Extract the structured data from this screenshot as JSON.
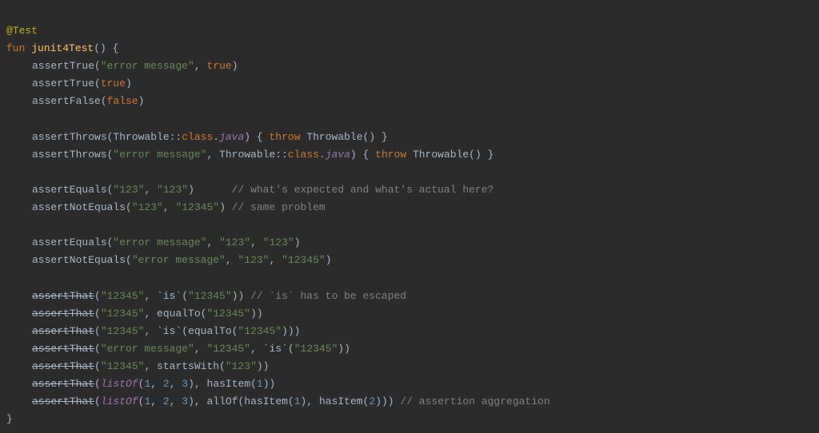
{
  "line1": {
    "annot": "@Test"
  },
  "line2": {
    "kw1": "fun",
    "fn": "junit4Test",
    "after": "() {"
  },
  "line3": {
    "call": "assertTrue(",
    "str": "\"error message\"",
    "rest": ", ",
    "kw": "true",
    "end": ")"
  },
  "line4": {
    "call": "assertTrue(",
    "kw": "true",
    "end": ")"
  },
  "line5": {
    "call": "assertFalse(",
    "kw": "false",
    "end": ")"
  },
  "line7": {
    "a": "assertThrows(Throwable::",
    "cls": "class",
    "dot": ".",
    "java": "java",
    "b": ") { ",
    "kw": "throw",
    "c": " Throwable() }"
  },
  "line8": {
    "a": "assertThrows(",
    "str": "\"error message\"",
    "b": ", Throwable::",
    "cls": "class",
    "dot": ".",
    "java": "java",
    "c": ") { ",
    "kw": "throw",
    "d": " Throwable() }"
  },
  "line10": {
    "a": "assertEquals(",
    "s1": "\"123\"",
    "b": ", ",
    "s2": "\"123\"",
    "c": ")      ",
    "cm": "// what's expected and what's actual here?"
  },
  "line11": {
    "a": "assertNotEquals(",
    "s1": "\"123\"",
    "b": ", ",
    "s2": "\"12345\"",
    "c": ") ",
    "cm": "// same problem"
  },
  "line13": {
    "a": "assertEquals(",
    "s1": "\"error message\"",
    "b": ", ",
    "s2": "\"123\"",
    "c": ", ",
    "s3": "\"123\"",
    "d": ")"
  },
  "line14": {
    "a": "assertNotEquals(",
    "s1": "\"error message\"",
    "b": ", ",
    "s2": "\"123\"",
    "c": ", ",
    "s3": "\"12345\"",
    "d": ")"
  },
  "line16": {
    "a": "assertThat",
    "b": "(",
    "s1": "\"12345\"",
    "c": ", `is`(",
    "s2": "\"12345\"",
    "d": ")) ",
    "cm": "// `is` has to be escaped"
  },
  "line17": {
    "a": "assertThat",
    "b": "(",
    "s1": "\"12345\"",
    "c": ", equalTo(",
    "s2": "\"12345\"",
    "d": "))"
  },
  "line18": {
    "a": "assertThat",
    "b": "(",
    "s1": "\"12345\"",
    "c": ", `is`(equalTo(",
    "s2": "\"12345\"",
    "d": ")))"
  },
  "line19": {
    "a": "assertThat",
    "b": "(",
    "s1": "\"error message\"",
    "c": ", ",
    "s2": "\"12345\"",
    "d": ", `is`(",
    "s3": "\"12345\"",
    "e": "))"
  },
  "line20": {
    "a": "assertThat",
    "b": "(",
    "s1": "\"12345\"",
    "c": ", startsWith(",
    "s2": "\"123\"",
    "d": "))"
  },
  "line21": {
    "a": "assertThat",
    "b": "(",
    "fn": "listOf",
    "c": "(",
    "n1": "1",
    "d": ", ",
    "n2": "2",
    "e": ", ",
    "n3": "3",
    "f": "), hasItem(",
    "n4": "1",
    "g": "))"
  },
  "line22": {
    "a": "assertThat",
    "b": "(",
    "fn": "listOf",
    "c": "(",
    "n1": "1",
    "d": ", ",
    "n2": "2",
    "e": ", ",
    "n3": "3",
    "f": "), allOf(hasItem(",
    "n4": "1",
    "g": "), hasItem(",
    "n5": "2",
    "h": "))) ",
    "cm": "// assertion aggregation"
  },
  "line23": {
    "close": "}"
  }
}
